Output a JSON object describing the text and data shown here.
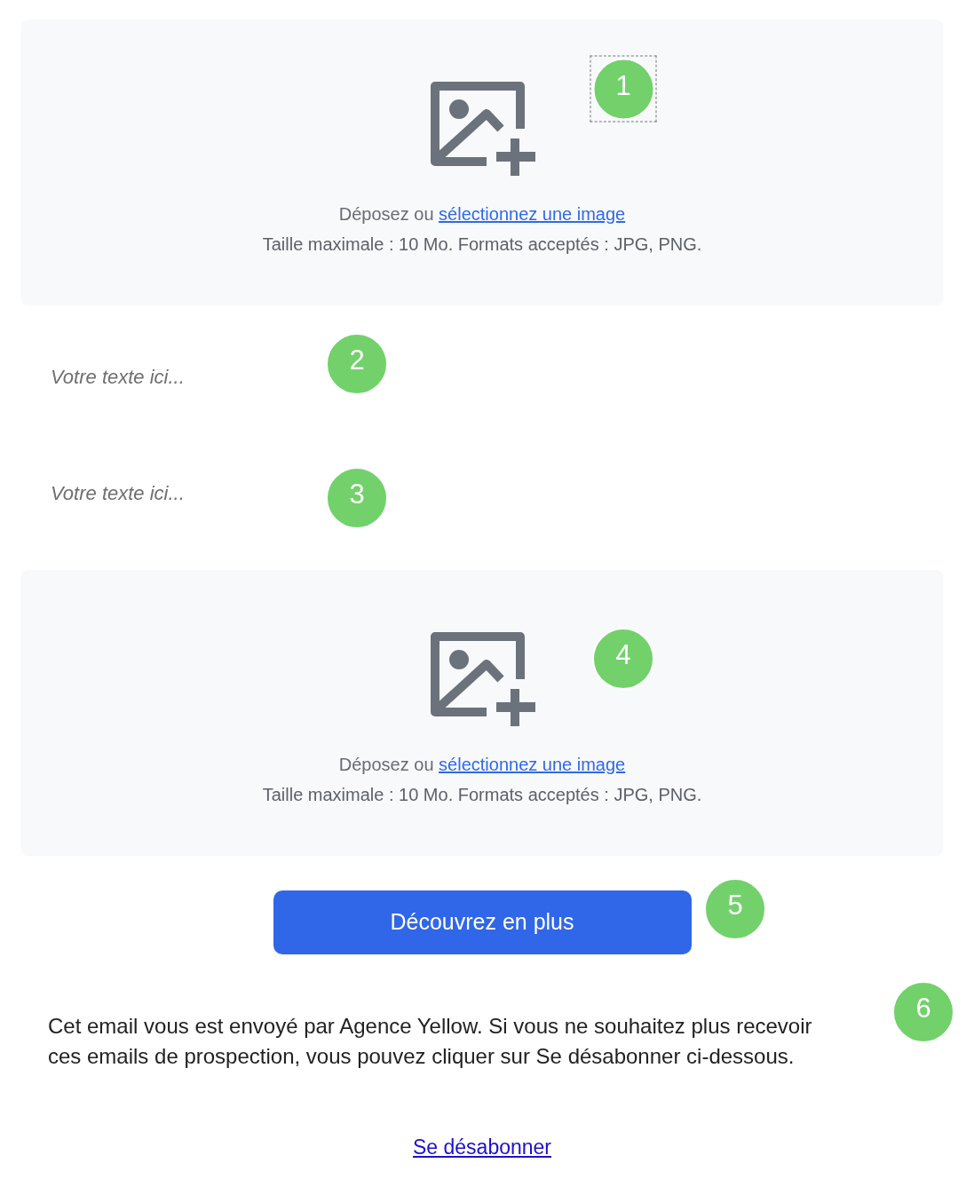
{
  "blocks": [
    {
      "kind": "image_upload",
      "prompt": "Déposez ou",
      "link": "sélectionnez une image",
      "limits": "Taille maximale : 10 Mo. Formats acceptés : JPG, PNG.",
      "marker": {
        "label": "1",
        "selected": true
      }
    },
    {
      "kind": "text",
      "placeholder": "Votre texte ici...",
      "marker": {
        "label": "2",
        "selected": false
      }
    },
    {
      "kind": "text",
      "placeholder": "Votre texte ici...",
      "marker": {
        "label": "3",
        "selected": false
      }
    },
    {
      "kind": "image_upload",
      "prompt": "Déposez ou",
      "link": "sélectionnez une image",
      "limits": "Taille maximale : 10 Mo. Formats acceptés : JPG, PNG.",
      "marker": {
        "label": "4",
        "selected": false
      }
    },
    {
      "kind": "button",
      "label": "Découvrez en plus",
      "marker": {
        "label": "5",
        "selected": false
      }
    },
    {
      "kind": "paragraph",
      "text": "Cet email vous est envoyé par Agence Yellow. Si vous ne souhaitez plus recevoir ces emails de prospection, vous pouvez cliquer sur Se désabonner ci-dessous.",
      "marker": {
        "label": "6",
        "selected": false
      }
    },
    {
      "kind": "link",
      "label": "Se désabonner"
    }
  ]
}
